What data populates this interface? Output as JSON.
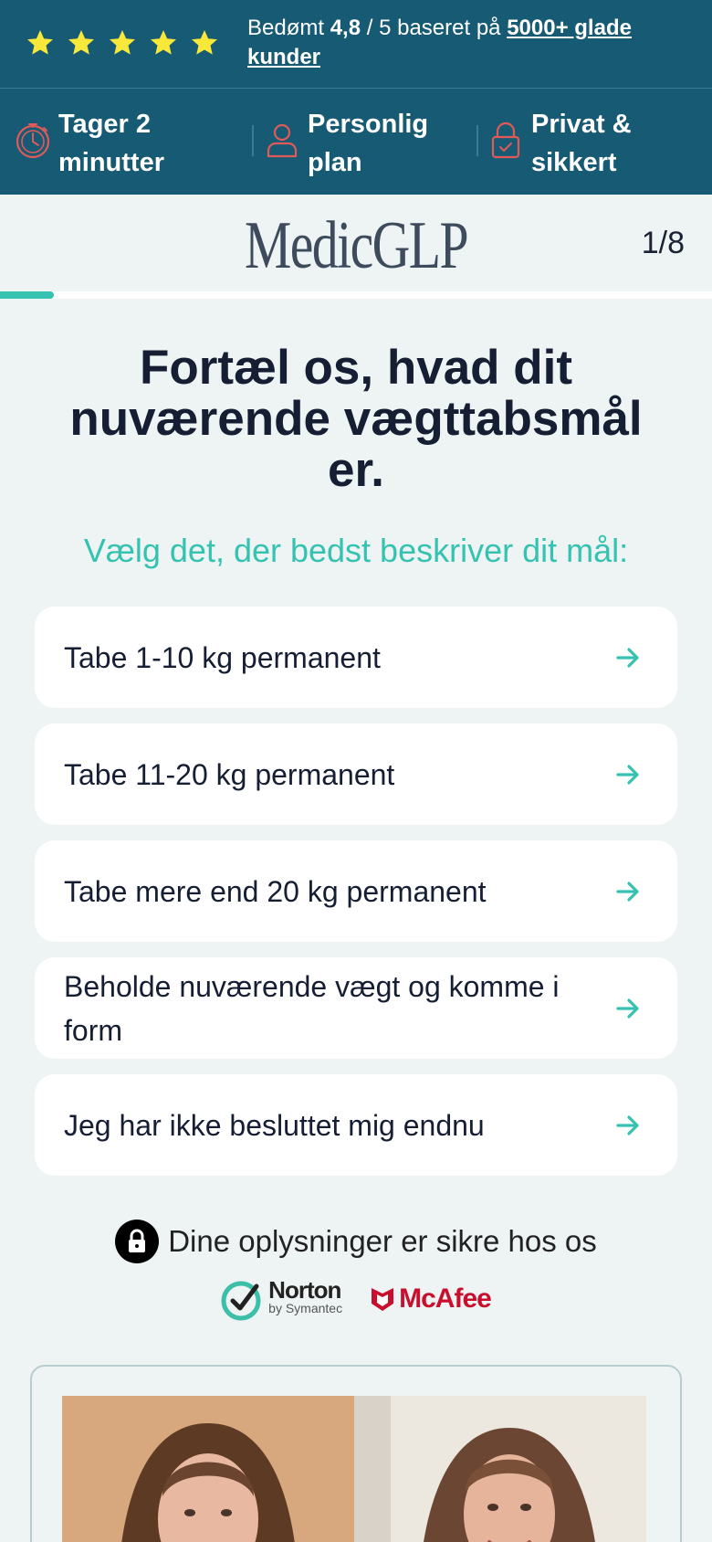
{
  "rating": {
    "stars": 5,
    "prefix": "Bedømt ",
    "score": "4,8",
    "suffix": " / 5 baseret på ",
    "link": "5000+ glade kunder",
    "star_color": "#f7e83a"
  },
  "features": [
    {
      "icon": "stopwatch-icon",
      "label": "Tager 2 minutter"
    },
    {
      "icon": "person-icon",
      "label": "Personlig plan"
    },
    {
      "icon": "padlock-icon",
      "label": "Privat & sikkert"
    }
  ],
  "header": {
    "logo": "MedicGLP",
    "step": "1/8"
  },
  "progress": {
    "current": 1,
    "total": 8,
    "fraction": 0.075
  },
  "question": "Fortæl os, hvad dit nuværende vægttabsmål er.",
  "subtitle": "Vælg det, der bedst beskriver dit mål:",
  "options": [
    "Tabe 1-10 kg permanent",
    "Tabe 11-20 kg permanent",
    "Tabe mere end 20 kg permanent",
    "Beholde nuværende vægt og komme i form",
    "Jeg har ikke besluttet mig endnu"
  ],
  "security": {
    "text": "Dine oplysninger er sikre hos os",
    "norton": "Norton",
    "norton_sub": "by Symantec",
    "mcafee": "McAfee"
  },
  "colors": {
    "header_bg": "#165a73",
    "accent": "#36c2b0",
    "page_bg": "#eef4f4",
    "icon_red": "#e05a5a"
  }
}
